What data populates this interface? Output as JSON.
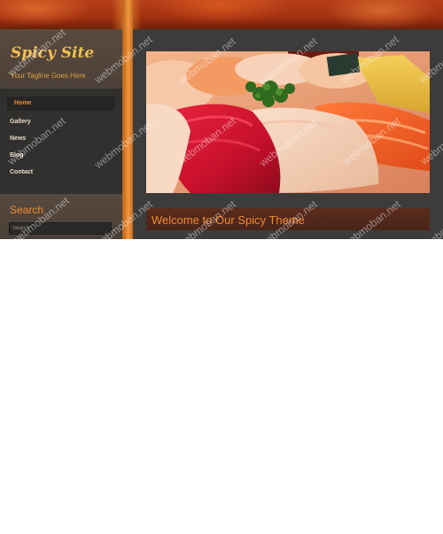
{
  "site": {
    "title": "Spicy Site",
    "tagline": "Your Tagline Goes Here"
  },
  "nav": {
    "items": [
      {
        "label": "Home",
        "active": true
      },
      {
        "label": "Gallery",
        "active": false
      },
      {
        "label": "News",
        "active": false
      },
      {
        "label": "Blog",
        "active": false
      },
      {
        "label": "Contact",
        "active": false
      }
    ]
  },
  "search": {
    "title": "Search",
    "placeholder": "Search"
  },
  "hero": {
    "alt": "sushi-image"
  },
  "main": {
    "welcome_title": "Welcome to Our Spicy Theme"
  },
  "watermark": {
    "text": "webmoban.net"
  },
  "colors": {
    "accent": "#f08a30",
    "title": "#f0c050",
    "banner": "#a32f10",
    "sidebar": "#31302e",
    "content": "#3d3c3a"
  }
}
